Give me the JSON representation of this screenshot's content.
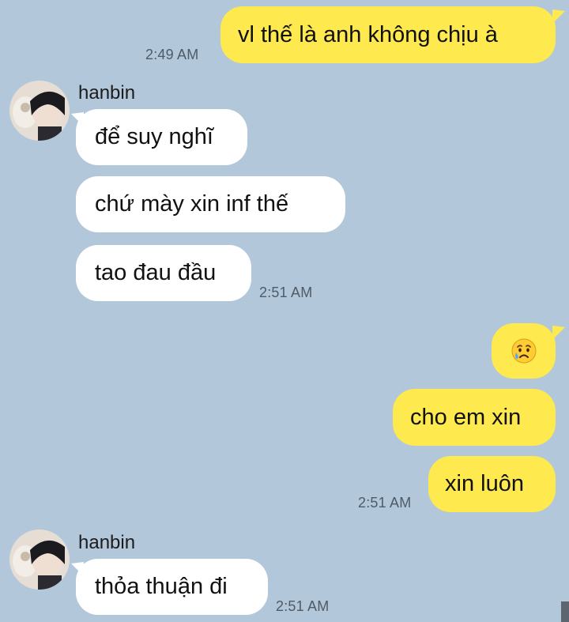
{
  "messages": [
    {
      "sender": "me",
      "text": "vl thế là anh không chịu à",
      "time": "2:49 AM"
    },
    {
      "sender": "hanbin",
      "name": "hanbin",
      "text": "để suy nghĩ"
    },
    {
      "sender": "hanbin",
      "text": "chứ mày xin inf thế"
    },
    {
      "sender": "hanbin",
      "text": "tao đau đầu",
      "time": "2:51 AM"
    },
    {
      "sender": "me",
      "emoji": "😥",
      "emoji_icon": "sad-relieved-face-emoji"
    },
    {
      "sender": "me",
      "text": "cho em xin"
    },
    {
      "sender": "me",
      "text": "xin luôn",
      "time": "2:51 AM"
    },
    {
      "sender": "hanbin",
      "name": "hanbin",
      "text": "thỏa thuận đi",
      "time": "2:51 AM"
    }
  ],
  "colors": {
    "background": "#b2c7da",
    "my_bubble": "#fee94e",
    "their_bubble": "#ffffff",
    "timestamp": "#4f5b66"
  }
}
